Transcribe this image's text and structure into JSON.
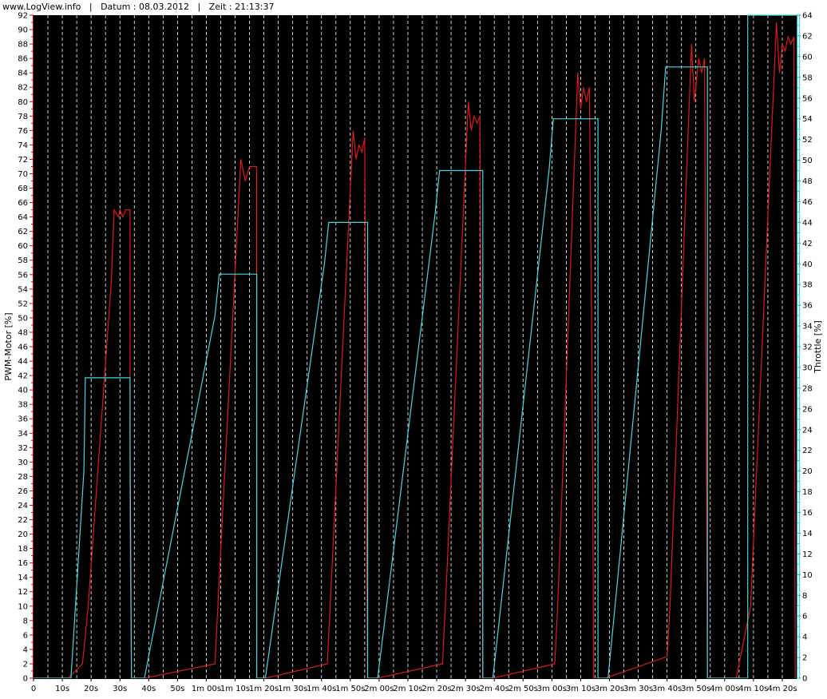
{
  "header": {
    "site": "www.LogView.info",
    "sep": "|",
    "date_label": "Datum : 08.03.2012",
    "time_label": "Zeit : 21:13:37"
  },
  "colors": {
    "background": "#000000",
    "grid": "#ffffff",
    "pwm_series": "#e01818",
    "throttle_series": "#40d8e8",
    "left_axis": "#cc0000",
    "right_axis": "#00bbbb"
  },
  "chart_data": {
    "type": "line",
    "title": "",
    "xlabel": "",
    "y_left_label": "PWM-Motor [%]",
    "y_right_label": "Throttle [%]",
    "x_range_seconds": [
      0,
      265
    ],
    "y_left_range": [
      0,
      92
    ],
    "y_right_range": [
      0,
      64
    ],
    "y_left_ticks": [
      0,
      2,
      4,
      6,
      8,
      10,
      12,
      14,
      16,
      18,
      20,
      22,
      24,
      26,
      28,
      30,
      32,
      34,
      36,
      38,
      40,
      42,
      44,
      46,
      48,
      50,
      52,
      54,
      56,
      58,
      60,
      62,
      64,
      66,
      68,
      70,
      72,
      74,
      76,
      78,
      80,
      82,
      84,
      86,
      88,
      90,
      92
    ],
    "y_right_ticks": [
      0,
      2,
      4,
      6,
      8,
      10,
      12,
      14,
      16,
      18,
      20,
      22,
      24,
      26,
      28,
      30,
      32,
      34,
      36,
      38,
      40,
      42,
      44,
      46,
      48,
      50,
      52,
      54,
      56,
      58,
      60,
      62,
      64
    ],
    "x_ticks": [
      "0",
      "10s",
      "20s",
      "30s",
      "40s",
      "50s",
      "1m 00s",
      "1m 10s",
      "1m 20s",
      "1m 30s",
      "1m 40s",
      "1m 50s",
      "2m 00s",
      "2m 10s",
      "2m 20s",
      "2m 30s",
      "2m 40s",
      "2m 50s",
      "3m 00s",
      "3m 10s",
      "3m 20s",
      "3m 30s",
      "3m 40s",
      "3m 50s",
      "4m 00s",
      "4m 10s",
      "4m 20s"
    ],
    "grid": true,
    "series": [
      {
        "name": "PWM-Motor [%]",
        "axis": "left",
        "points": [
          [
            0,
            0
          ],
          [
            10.5,
            0
          ],
          [
            12,
            0
          ],
          [
            17,
            2
          ],
          [
            19,
            10
          ],
          [
            27,
            55
          ],
          [
            28,
            65
          ],
          [
            29.5,
            64
          ],
          [
            30,
            65
          ],
          [
            31,
            64
          ],
          [
            32,
            65
          ],
          [
            33.5,
            65
          ],
          [
            33.5,
            21
          ],
          [
            34,
            0
          ],
          [
            38,
            0
          ],
          [
            38.5,
            0
          ],
          [
            63,
            2
          ],
          [
            64,
            10
          ],
          [
            72,
            72
          ],
          [
            73.5,
            69
          ],
          [
            75,
            71
          ],
          [
            77.5,
            71
          ],
          [
            77.5,
            0
          ],
          [
            80,
            0
          ],
          [
            80.5,
            0
          ],
          [
            102,
            2
          ],
          [
            103,
            10
          ],
          [
            111,
            76
          ],
          [
            112,
            72
          ],
          [
            113,
            74
          ],
          [
            114,
            73
          ],
          [
            115,
            75
          ],
          [
            115.5,
            32
          ],
          [
            116,
            0
          ],
          [
            119,
            0
          ],
          [
            119.5,
            0
          ],
          [
            142,
            2
          ],
          [
            143,
            10
          ],
          [
            151,
            80
          ],
          [
            152,
            76
          ],
          [
            153,
            78
          ],
          [
            154,
            77
          ],
          [
            155,
            78
          ],
          [
            155.5,
            35
          ],
          [
            156,
            0
          ],
          [
            159,
            0
          ],
          [
            159.5,
            0
          ],
          [
            181,
            2
          ],
          [
            182,
            10
          ],
          [
            189,
            84
          ],
          [
            190,
            79
          ],
          [
            191,
            82
          ],
          [
            192,
            80
          ],
          [
            193,
            82
          ],
          [
            194,
            40
          ],
          [
            194.5,
            0
          ],
          [
            198,
            0
          ],
          [
            198.5,
            0
          ],
          [
            220,
            3
          ],
          [
            221,
            10
          ],
          [
            228.5,
            88
          ],
          [
            229.5,
            80
          ],
          [
            231,
            86
          ],
          [
            232,
            84
          ],
          [
            233,
            86
          ],
          [
            233.5,
            43
          ],
          [
            234,
            0
          ],
          [
            243,
            0
          ],
          [
            244,
            0
          ],
          [
            249,
            10
          ],
          [
            258,
            91
          ],
          [
            259,
            84
          ],
          [
            260,
            88
          ],
          [
            261,
            87
          ],
          [
            262,
            89
          ],
          [
            263,
            88
          ],
          [
            264,
            89
          ],
          [
            264.5,
            0
          ]
        ]
      },
      {
        "name": "Throttle [%]",
        "axis": "right",
        "points": [
          [
            0,
            0
          ],
          [
            11,
            0
          ],
          [
            13,
            0
          ],
          [
            17.5,
            20
          ],
          [
            18,
            29
          ],
          [
            33.5,
            29
          ],
          [
            33.5,
            23
          ],
          [
            34,
            0
          ],
          [
            38,
            0
          ],
          [
            38.5,
            0
          ],
          [
            63,
            35
          ],
          [
            64.5,
            39
          ],
          [
            77.5,
            39
          ],
          [
            77.5,
            0
          ],
          [
            80,
            0
          ],
          [
            80.5,
            0
          ],
          [
            101,
            40
          ],
          [
            102.5,
            44
          ],
          [
            116,
            44
          ],
          [
            116,
            0
          ],
          [
            119,
            0
          ],
          [
            119.5,
            0
          ],
          [
            139.5,
            45
          ],
          [
            141,
            49
          ],
          [
            156,
            49
          ],
          [
            156,
            0
          ],
          [
            159,
            0
          ],
          [
            159.5,
            0
          ],
          [
            179,
            49
          ],
          [
            180.5,
            54
          ],
          [
            196,
            54
          ],
          [
            196,
            0
          ],
          [
            199,
            0
          ],
          [
            199.5,
            0
          ],
          [
            218,
            53
          ],
          [
            219.5,
            59
          ],
          [
            234,
            59
          ],
          [
            234,
            0
          ],
          [
            248,
            0
          ],
          [
            248,
            64
          ],
          [
            266,
            64
          ],
          [
            266,
            0
          ]
        ]
      }
    ]
  }
}
